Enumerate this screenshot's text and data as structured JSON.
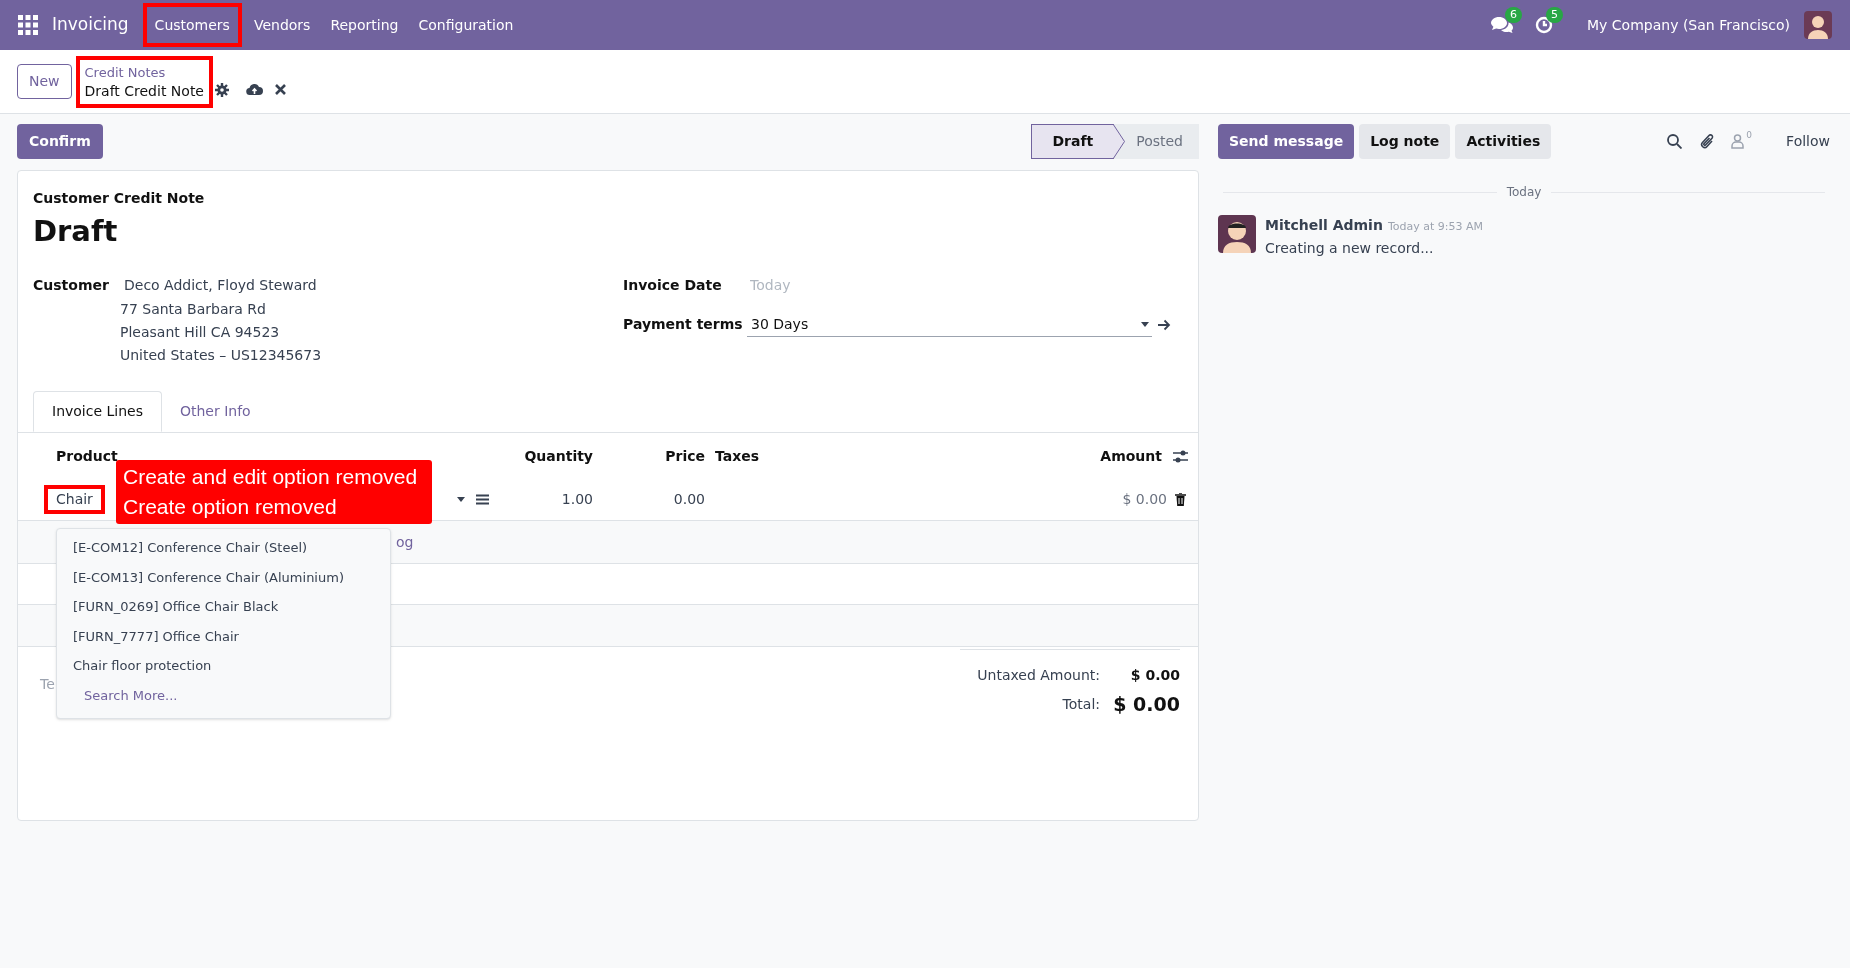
{
  "navbar": {
    "app": "Invoicing",
    "menus": [
      {
        "label": "Customers",
        "highlighted": true
      },
      {
        "label": "Vendors",
        "highlighted": false
      },
      {
        "label": "Reporting",
        "highlighted": false
      },
      {
        "label": "Configuration",
        "highlighted": false
      }
    ],
    "messages_count": "6",
    "activities_count": "5",
    "company": "My Company (San Francisco)"
  },
  "control_panel": {
    "new_button": "New",
    "breadcrumb": "Credit Notes",
    "record": "Draft Credit Note",
    "highlighted": true
  },
  "confirm_button": "Confirm",
  "statusbar": [
    {
      "label": "Draft",
      "selected": true
    },
    {
      "label": "Posted",
      "selected": false
    }
  ],
  "chatter": {
    "buttons": [
      {
        "label": "Send message",
        "kind": "primary"
      },
      {
        "label": "Log note",
        "kind": "secondary"
      },
      {
        "label": "Activities",
        "kind": "secondary"
      }
    ],
    "follower_count": "0",
    "follow": "Follow",
    "divider": "Today",
    "messages": [
      {
        "author": "Mitchell Admin",
        "time": "Today at 9:53 AM",
        "body": "Creating a new record..."
      }
    ]
  },
  "form": {
    "type_label": "Customer Credit Note",
    "title": "Draft",
    "customer_label": "Customer",
    "customer_lines": [
      "Deco Addict, Floyd Steward",
      "77 Santa Barbara Rd",
      "Pleasant Hill CA 94523",
      "United States – US12345673"
    ],
    "invoice_date_label": "Invoice Date",
    "invoice_date_placeholder": "Today",
    "payment_terms_label": "Payment terms",
    "payment_terms": "30 Days",
    "tabs": [
      {
        "label": "Invoice Lines",
        "selected": true
      },
      {
        "label": "Other Info",
        "selected": false
      }
    ],
    "columns": [
      "Product",
      "Quantity",
      "Price",
      "Taxes",
      "Amount"
    ],
    "line": {
      "product": "Chair",
      "highlighted": true,
      "quantity": "1.00",
      "price": "0.00",
      "amount": "$ 0.00"
    },
    "add_line_fragment": "og",
    "terms_fragment": "Te",
    "dropdown": [
      {
        "label": "[E-COM12] Conference Chair (Steel)",
        "kind": "option"
      },
      {
        "label": "[E-COM13] Conference Chair (Aluminium)",
        "kind": "option"
      },
      {
        "label": "[FURN_0269] Office Chair Black",
        "kind": "option"
      },
      {
        "label": "[FURN_7777] Office Chair",
        "kind": "option"
      },
      {
        "label": "Chair floor protection",
        "kind": "option"
      },
      {
        "label": "Search More...",
        "kind": "link"
      }
    ],
    "totals": [
      {
        "label": "Untaxed Amount:",
        "value": "$ 0.00",
        "kind": "subtotal"
      },
      {
        "label": "Total:",
        "value": "$ 0.00",
        "kind": "grand"
      }
    ]
  },
  "annotations": [
    "Create and edit option removed",
    "Create option removed"
  ]
}
